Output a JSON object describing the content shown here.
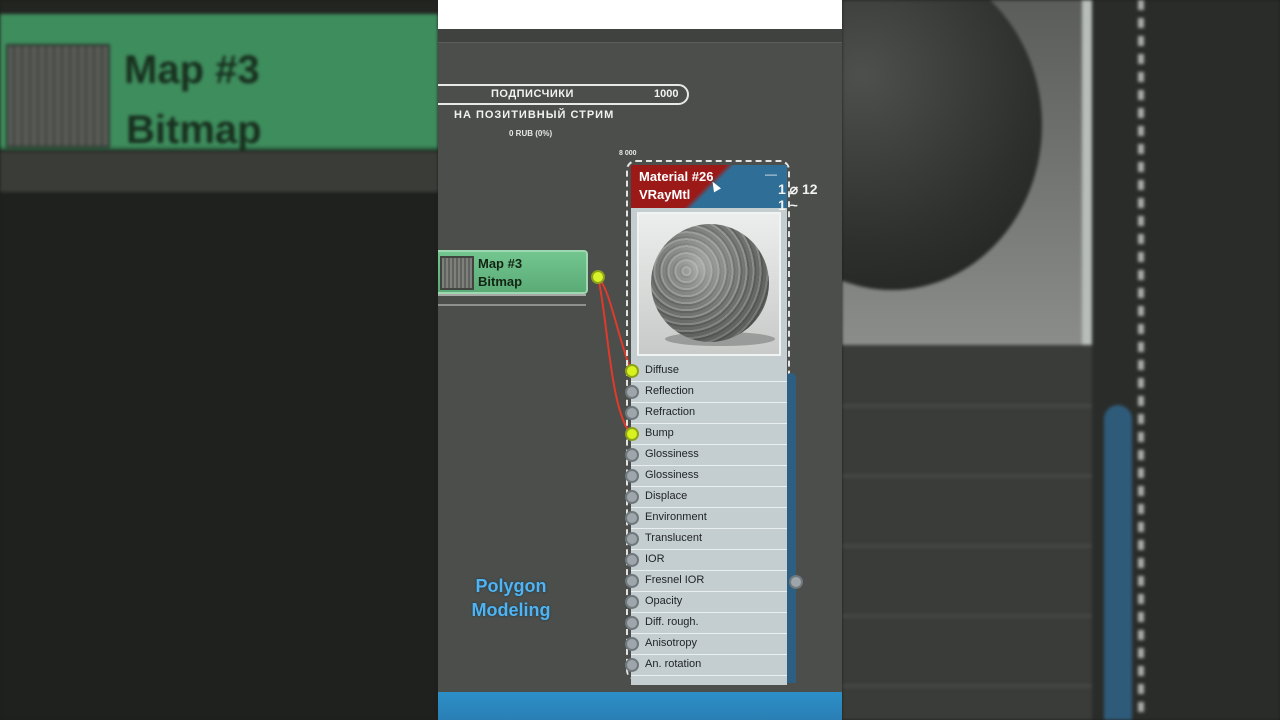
{
  "left_panel": {
    "bitmap_name": "Map #3",
    "bitmap_type": "Bitmap"
  },
  "stream_widget": {
    "label": "ПОДПИСЧИКИ",
    "count": "1000",
    "subtitle": "НА ПОЗИТИВНЫЙ СТРИМ",
    "amount": "0 RUB (0%)"
  },
  "coord_tag": "8 000",
  "bitmap_node": {
    "name": "Map #3",
    "type": "Bitmap"
  },
  "material_node": {
    "name": "Material #26",
    "type": "VRayMtl",
    "minimize": "—",
    "slots": [
      {
        "label": "Diffuse",
        "connected": true
      },
      {
        "label": "Reflection",
        "connected": false
      },
      {
        "label": "Refraction",
        "connected": false
      },
      {
        "label": "Bump",
        "connected": true
      },
      {
        "label": "Glossiness",
        "connected": false
      },
      {
        "label": "Glossiness",
        "connected": false
      },
      {
        "label": "Displace",
        "connected": false
      },
      {
        "label": "Environment",
        "connected": false
      },
      {
        "label": "Translucent",
        "connected": false
      },
      {
        "label": "IOR",
        "connected": false
      },
      {
        "label": "Fresnel IOR",
        "connected": false
      },
      {
        "label": "Opacity",
        "connected": false
      },
      {
        "label": "Diff. rough.",
        "connected": false
      },
      {
        "label": "Anisotropy",
        "connected": false
      },
      {
        "label": "An. rotation",
        "connected": false
      }
    ]
  },
  "mini_readout": {
    "line1": "1 ⌀ 12",
    "line2": "1 ~"
  },
  "watermark": {
    "line1": "Polygon",
    "line2": "Modeling"
  },
  "colors": {
    "wire": "#e03a2c",
    "connected_socket": "#d8f21e",
    "material_header_red": "#9b1a18",
    "material_header_blue": "#2f6e96",
    "bitmap_green": "#5aab75",
    "watermark_blue": "#4fb4f1"
  }
}
